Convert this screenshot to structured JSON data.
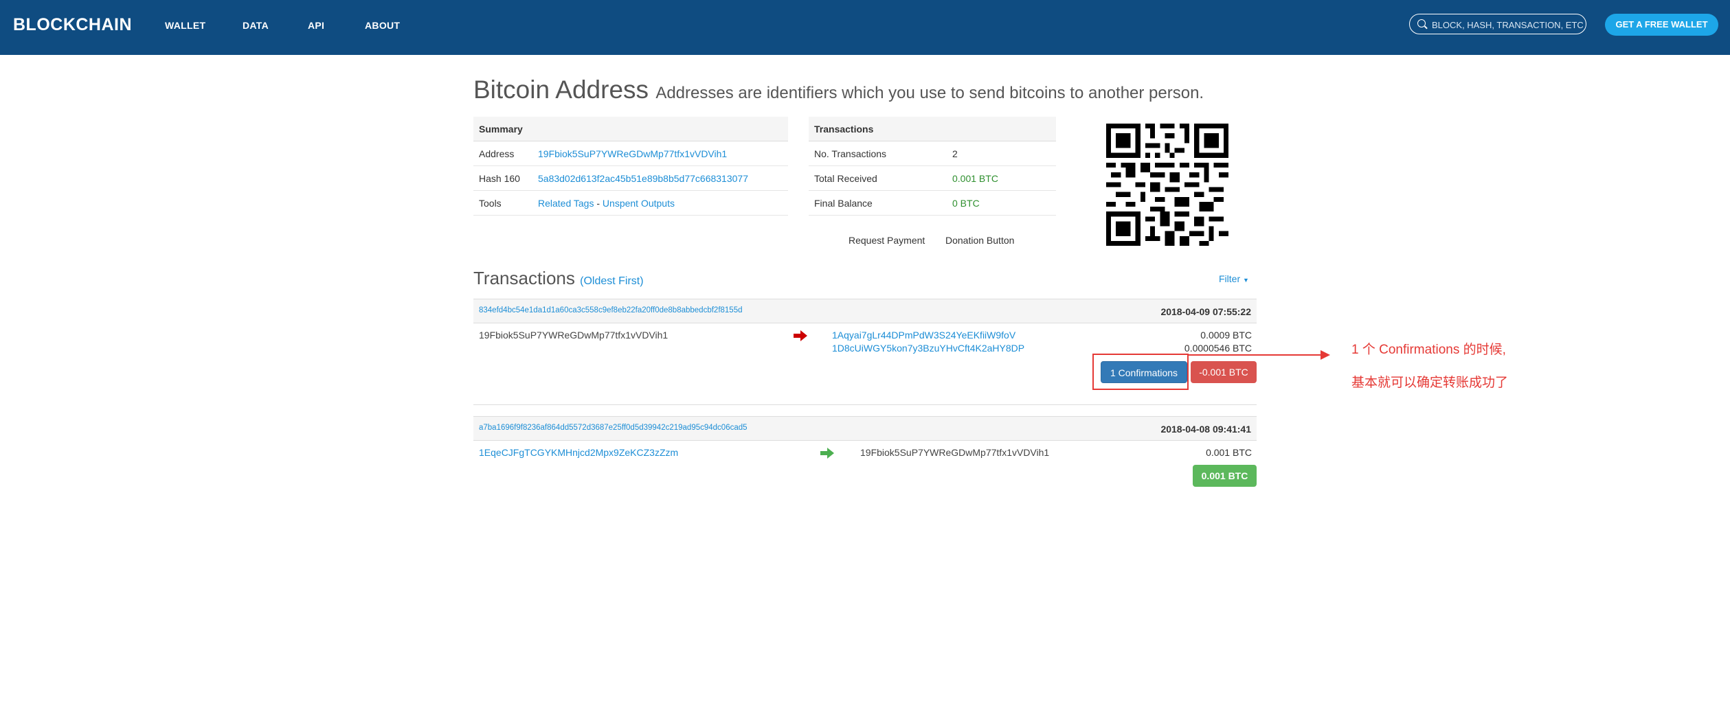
{
  "header": {
    "logo": "BLOCKCHAIN",
    "nav": [
      "WALLET",
      "DATA",
      "API",
      "ABOUT"
    ],
    "search_placeholder": "BLOCK, HASH, TRANSACTION, ETC...",
    "cta": "GET A FREE WALLET"
  },
  "page": {
    "title": "Bitcoin Address",
    "subtitle": "Addresses are identifiers which you use to send bitcoins to another person."
  },
  "summary": {
    "heading": "Summary",
    "rows": [
      {
        "label": "Address",
        "value": "19Fbiok5SuP7YWReGDwMp77tfx1vVDVih1"
      },
      {
        "label": "Hash 160",
        "value": "5a83d02d613f2ac45b51e89b8b5d77c668313077"
      },
      {
        "label": "Tools",
        "link1": "Related Tags",
        "sep": " - ",
        "link2": "Unspent Outputs"
      }
    ]
  },
  "tx_summary": {
    "heading": "Transactions",
    "rows": [
      {
        "label": "No. Transactions",
        "value": "2"
      },
      {
        "label": "Total Received",
        "value": "0.001 BTC"
      },
      {
        "label": "Final Balance",
        "value": "0 BTC"
      }
    ]
  },
  "links": {
    "request_payment": "Request Payment",
    "donation_button": "Donation Button"
  },
  "transactions_section": {
    "title": "Transactions",
    "order": "(Oldest First)",
    "filter": "Filter"
  },
  "transactions": [
    {
      "hash": "834efd4bc54e1da1d1a60ca3c558c9ef8eb22fa20ff0de8b8abbedcbf2f8155d",
      "time": "2018-04-09 07:55:22",
      "from": "19Fbiok5SuP7YWReGDwMp77tfx1vVDVih1",
      "to": [
        "1Aqyai7gLr44DPmPdW3S24YeEKfiiW9foV",
        "1D8cUiWGY5kon7y3BzuYHvCft4K2aHY8DP"
      ],
      "amounts": [
        "0.0009 BTC",
        "0.0000546 BTC"
      ],
      "confirmations": "1 Confirmations",
      "result": "-0.001 BTC",
      "direction": "out"
    },
    {
      "hash": "a7ba1696f9f8236af864dd5572d3687e25ff0d5d39942c219ad95c94dc06cad5",
      "time": "2018-04-08 09:41:41",
      "from": "1EqeCJFgTCGYKMHnjcd2Mpx9ZeKCZ3zZzm",
      "to": [
        "19Fbiok5SuP7YWReGDwMp77tfx1vVDVih1"
      ],
      "amounts": [
        "0.001 BTC"
      ],
      "result": "0.001 BTC",
      "direction": "in"
    }
  ],
  "annotation": {
    "line1": "1 个 Confirmations 的时候,",
    "line2": "基本就可以确定转账成功了",
    "color": "#e53935"
  },
  "colors": {
    "header_bg": "#0f4c81",
    "link": "#1d8ed6",
    "cta": "#1da6e8",
    "confirm_btn": "#337ab7",
    "negative": "#d9534f",
    "positive": "#5cb85c",
    "out_arrow": "#cc0000",
    "in_arrow": "#4caf50"
  }
}
